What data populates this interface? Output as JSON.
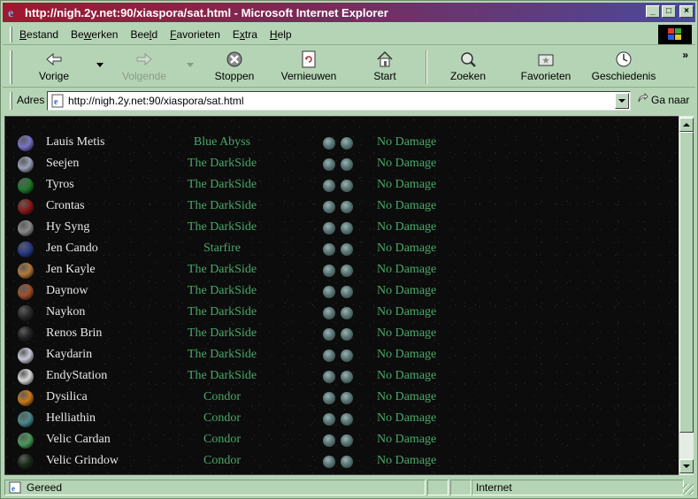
{
  "window": {
    "title": "http://nigh.2y.net:90/xiaspora/sat.html - Microsoft Internet Explorer",
    "controls": {
      "minimize": "_",
      "maximize": "□",
      "close": "×"
    }
  },
  "menu": {
    "items": [
      {
        "label": "Bestand",
        "accel": "B",
        "rest": "estand"
      },
      {
        "label": "Bewerken",
        "pre": "Be",
        "accel": "w",
        "rest": "erken"
      },
      {
        "label": "Beeld",
        "pre": "Bee",
        "accel": "l",
        "rest": "d"
      },
      {
        "label": "Favorieten",
        "accel": "F",
        "rest": "avorieten"
      },
      {
        "label": "Extra",
        "pre": "E",
        "accel": "x",
        "rest": "tra"
      },
      {
        "label": "Help",
        "accel": "H",
        "rest": "elp"
      }
    ]
  },
  "toolbar": {
    "back": "Vorige",
    "forward": "Volgende",
    "stop": "Stoppen",
    "refresh": "Vernieuwen",
    "home": "Start",
    "search": "Zoeken",
    "favorites": "Favorieten",
    "history": "Geschiedenis",
    "more": "»"
  },
  "address": {
    "label": "Adres",
    "url": "http://nigh.2y.net:90/xiaspora/sat.html",
    "go": "Ga naar"
  },
  "planets": [
    {
      "name": "Lauis Metis",
      "faction": "Blue Abyss",
      "status": "No Damage",
      "color": "#7a72c8"
    },
    {
      "name": "Seejen",
      "faction": "The DarkSide",
      "status": "No Damage",
      "color": "#9aa0b8"
    },
    {
      "name": "Tyros",
      "faction": "The DarkSide",
      "status": "No Damage",
      "color": "#1f7a2a"
    },
    {
      "name": "Crontas",
      "faction": "The DarkSide",
      "status": "No Damage",
      "color": "#8a1a1a"
    },
    {
      "name": "Hy Syng",
      "faction": "The DarkSide",
      "status": "No Damage",
      "color": "#8a8a8a"
    },
    {
      "name": "Jen Cando",
      "faction": "Starfire",
      "status": "No Damage",
      "color": "#2a3a8a"
    },
    {
      "name": "Jen Kayle",
      "faction": "The DarkSide",
      "status": "No Damage",
      "color": "#b07a3a"
    },
    {
      "name": "Daynow",
      "faction": "The DarkSide",
      "status": "No Damage",
      "color": "#a0502a"
    },
    {
      "name": "Naykon",
      "faction": "The DarkSide",
      "status": "No Damage",
      "color": "#2a2a2a"
    },
    {
      "name": "Renos Brin",
      "faction": "The DarkSide",
      "status": "No Damage",
      "color": "#222222"
    },
    {
      "name": "Kaydarin",
      "faction": "The DarkSide",
      "status": "No Damage",
      "color": "#c8c8d8"
    },
    {
      "name": "EndyStation",
      "faction": "The DarkSide",
      "status": "No Damage",
      "color": "#d8d8d8"
    },
    {
      "name": "Dysilica",
      "faction": "Condor",
      "status": "No Damage",
      "color": "#c87a1a"
    },
    {
      "name": "Helliathin",
      "faction": "Condor",
      "status": "No Damage",
      "color": "#4a8a8a"
    },
    {
      "name": "Velic Cardan",
      "faction": "Condor",
      "status": "No Damage",
      "color": "#4a9a5a"
    },
    {
      "name": "Velic Grindow",
      "faction": "Condor",
      "status": "No Damage",
      "color": "#1a2a1a"
    }
  ],
  "status": {
    "text": "Gereed",
    "zone": "Internet"
  }
}
